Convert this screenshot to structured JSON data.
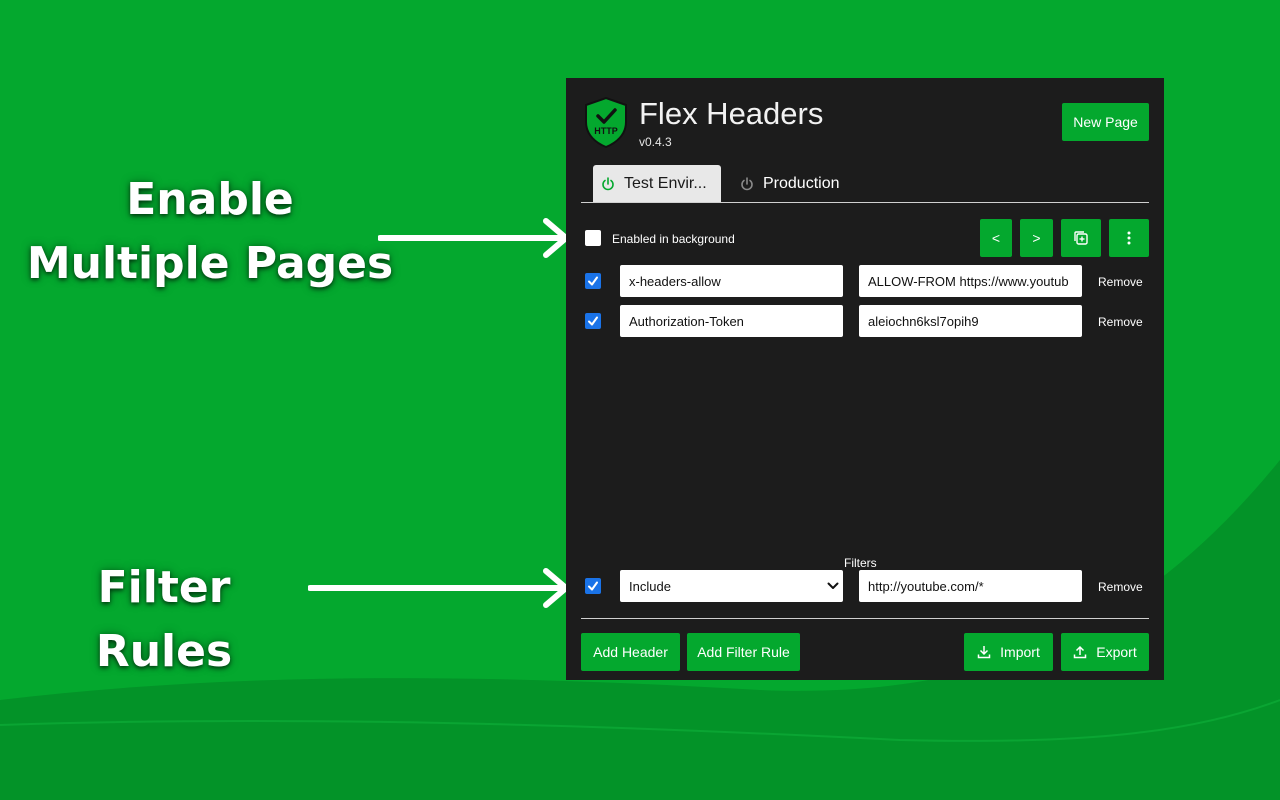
{
  "colors": {
    "background_green": "#04a82e",
    "panel_bg": "#1c1c1c",
    "accent_green": "#04a82e",
    "checkbox_blue": "#1a73e8"
  },
  "callouts": {
    "multiple_pages": "Enable Multiple Pages",
    "filter_rules": "Filter Rules"
  },
  "app": {
    "logo_icon": "shield-check-http-icon",
    "logo_text": "HTTP",
    "title": "Flex Headers",
    "version": "v0.4.3",
    "new_page_label": "New Page"
  },
  "tabs": [
    {
      "label": "Test Envir...",
      "active": true,
      "icon": "power-icon"
    },
    {
      "label": "Production",
      "active": false,
      "icon": "power-icon"
    }
  ],
  "toolbar": {
    "enabled_in_background": {
      "label": "Enabled in background",
      "checked": false
    },
    "prev_label": "<",
    "next_label": ">",
    "copy_icon": "copy-add-icon",
    "menu_icon": "more-vert-icon"
  },
  "headers": [
    {
      "enabled": true,
      "name": "x-headers-allow",
      "value": "ALLOW-FROM https://www.youtub",
      "remove_label": "Remove"
    },
    {
      "enabled": true,
      "name": "Authorization-Token",
      "value": "aleiochn6ksl7opih9",
      "remove_label": "Remove"
    }
  ],
  "filters": {
    "section_label": "Filters",
    "rules": [
      {
        "enabled": true,
        "type": "Include",
        "pattern": "http://youtube.com/*",
        "remove_label": "Remove"
      }
    ]
  },
  "footer": {
    "add_header_label": "Add Header",
    "add_filter_rule_label": "Add Filter Rule",
    "import_label": "Import",
    "import_icon": "download-icon",
    "export_label": "Export",
    "export_icon": "upload-icon"
  }
}
